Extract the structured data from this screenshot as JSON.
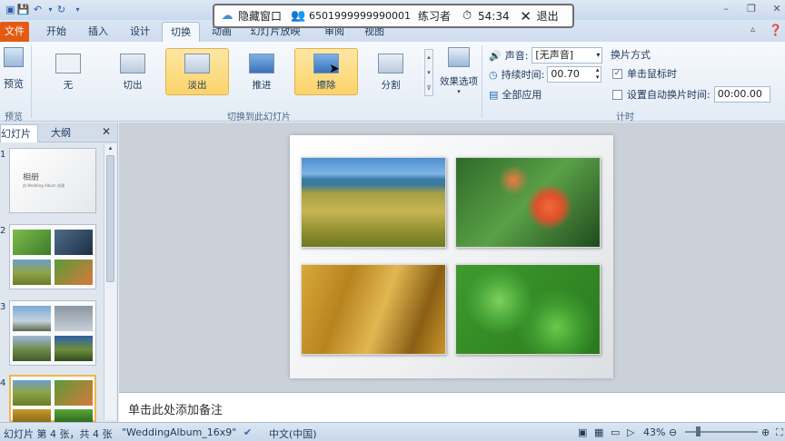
{
  "overlay": {
    "hide_window": "隐藏窗口",
    "exam_id": "6501999999990001",
    "user_name": "练习者",
    "timer": "54:34",
    "exit": "退出"
  },
  "tabs": [
    "文件",
    "开始",
    "插入",
    "设计",
    "切换",
    "动画",
    "幻灯片放映",
    "审阅",
    "视图"
  ],
  "ribbon": {
    "preview_label": "预览",
    "preview_group": "预览",
    "transitions": [
      {
        "label": "无"
      },
      {
        "label": "切出"
      },
      {
        "label": "淡出"
      },
      {
        "label": "推进"
      },
      {
        "label": "擦除"
      },
      {
        "label": "分割"
      }
    ],
    "effect_options": "效果选项",
    "transition_group": "切换到此幻灯片",
    "sound_label": "声音:",
    "sound_value": "[无声音]",
    "duration_label": "持续时间:",
    "duration_value": "00.70",
    "apply_all": "全部应用",
    "advance_title": "换片方式",
    "on_click": "单击鼠标时",
    "auto_after": "设置自动换片时间:",
    "auto_value": "00:00.00",
    "timing_group": "计时"
  },
  "panel": {
    "tab_slides": "幻灯片",
    "tab_outline": "大纲",
    "slide1_title": "相册",
    "slide1_sub": "由 Wedding Album 创建",
    "slide_numbers": [
      "1",
      "2",
      "3",
      "4"
    ]
  },
  "notes_placeholder": "单击此处添加备注",
  "status": {
    "slide_info": "幻灯片 第 4 张，共 4 张",
    "theme": "\"WeddingAlbum_16x9\"",
    "language": "中文(中国)",
    "zoom": "43%"
  },
  "colors": {
    "file_tab": "#e35b12",
    "selected": "#fbd36a"
  }
}
